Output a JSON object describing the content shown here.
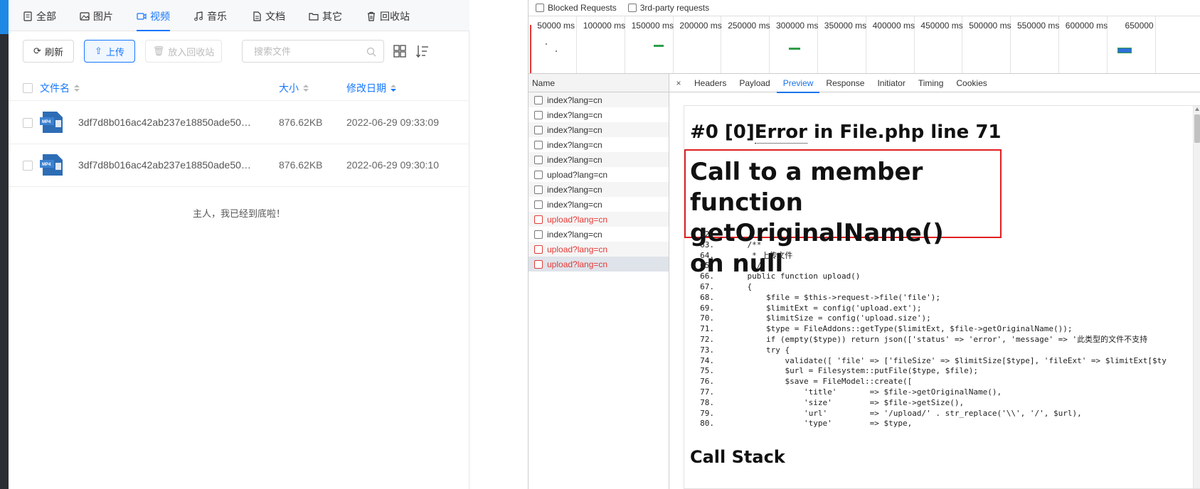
{
  "file_manager": {
    "tabs": [
      {
        "label": "全部",
        "icon": "document-list-icon"
      },
      {
        "label": "图片",
        "icon": "image-icon"
      },
      {
        "label": "视频",
        "icon": "video-icon"
      },
      {
        "label": "音乐",
        "icon": "music-icon"
      },
      {
        "label": "文档",
        "icon": "document-icon"
      },
      {
        "label": "其它",
        "icon": "folder-icon"
      },
      {
        "label": "回收站",
        "icon": "trash-icon"
      }
    ],
    "active_tab": "视频",
    "toolbar": {
      "refresh": "刷新",
      "upload": "上传",
      "recycle": "放入回收站",
      "search_placeholder": "搜索文件"
    },
    "columns": {
      "name": "文件名",
      "size": "大小",
      "date": "修改日期"
    },
    "files": [
      {
        "name": "3df7d8b016ac42ab237e18850ade501...",
        "size": "876.62KB",
        "date": "2022-06-29 09:33:09",
        "type": "MP4"
      },
      {
        "name": "3df7d8b016ac42ab237e18850ade501...",
        "size": "876.62KB",
        "date": "2022-06-29 09:30:10",
        "type": "MP4"
      }
    ],
    "end_note": "主人，我已经到底啦！"
  },
  "devtools": {
    "filters": {
      "blocked": "Blocked Requests",
      "third_party": "3rd-party requests"
    },
    "ticks": [
      "50000 ms",
      "100000 ms",
      "150000 ms",
      "200000 ms",
      "250000 ms",
      "300000 ms",
      "350000 ms",
      "400000 ms",
      "450000 ms",
      "500000 ms",
      "550000 ms",
      "600000 ms",
      "650000"
    ],
    "name_header": "Name",
    "requests": [
      {
        "name": "index?lang=cn",
        "error": false
      },
      {
        "name": "index?lang=cn",
        "error": false
      },
      {
        "name": "index?lang=cn",
        "error": false
      },
      {
        "name": "index?lang=cn",
        "error": false
      },
      {
        "name": "index?lang=cn",
        "error": false
      },
      {
        "name": "upload?lang=cn",
        "error": false
      },
      {
        "name": "index?lang=cn",
        "error": false
      },
      {
        "name": "index?lang=cn",
        "error": false
      },
      {
        "name": "upload?lang=cn",
        "error": true
      },
      {
        "name": "index?lang=cn",
        "error": false
      },
      {
        "name": "upload?lang=cn",
        "error": true
      },
      {
        "name": "upload?lang=cn",
        "error": true
      }
    ],
    "detail_tabs": [
      "Headers",
      "Payload",
      "Preview",
      "Response",
      "Initiator",
      "Timing",
      "Cookies"
    ],
    "active_detail_tab": "Preview",
    "close_glyph": "×",
    "preview": {
      "heading_prefix": "#0 [0]",
      "heading_error": "Error",
      "heading_suffix": " in File.php line 71",
      "message": "Call to a member function getOriginalName() on null",
      "code_lines": [
        {
          "n": "62.",
          "t": ""
        },
        {
          "n": "63.",
          "t": "    /**"
        },
        {
          "n": "64.",
          "t": "     * 上传文件"
        },
        {
          "n": "65.",
          "t": "     */"
        },
        {
          "n": "66.",
          "t": "    public function upload()"
        },
        {
          "n": "67.",
          "t": "    {"
        },
        {
          "n": "68.",
          "t": "        $file = $this->request->file('file');"
        },
        {
          "n": "69.",
          "t": "        $limitExt = config('upload.ext');"
        },
        {
          "n": "70.",
          "t": "        $limitSize = config('upload.size');"
        },
        {
          "n": "71.",
          "t": "        $type = FileAddons::getType($limitExt, $file->getOriginalName());"
        },
        {
          "n": "72.",
          "t": "        if (empty($type)) return json(['status' => 'error', 'message' => '此类型的文件不支持"
        },
        {
          "n": "73.",
          "t": "        try {"
        },
        {
          "n": "74.",
          "t": "            validate([ 'file' => ['fileSize' => $limitSize[$type], 'fileExt' => $limitExt[$ty"
        },
        {
          "n": "75.",
          "t": "            $url = Filesystem::putFile($type, $file);"
        },
        {
          "n": "76.",
          "t": "            $save = FileModel::create(["
        },
        {
          "n": "77.",
          "t": "                'title'       => $file->getOriginalName(),"
        },
        {
          "n": "78.",
          "t": "                'size'        => $file->getSize(),"
        },
        {
          "n": "79.",
          "t": "                'url'         => '/upload/' . str_replace('\\\\', '/', $url),"
        },
        {
          "n": "80.",
          "t": "                'type'        => $type,"
        }
      ],
      "call_stack": "Call Stack"
    }
  },
  "colors": {
    "accent": "#1677ff",
    "error": "#e53935",
    "highlight_box": "#e02020"
  }
}
